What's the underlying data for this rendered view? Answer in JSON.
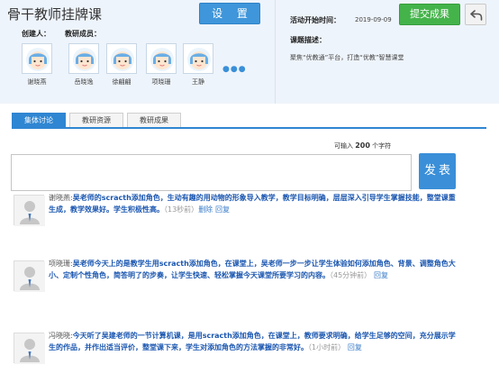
{
  "header": {
    "title": "骨干教师挂牌课",
    "settings_label": "设 置",
    "creator_label": "创建人：",
    "members_label": "教研成员："
  },
  "members": [
    {
      "name": "谢晓燕"
    },
    {
      "name": "岳晓逸"
    },
    {
      "name": "徐翩翩"
    },
    {
      "name": "项晓珊"
    },
    {
      "name": "王静"
    }
  ],
  "more_label": "●●●",
  "activity": {
    "start_label": "活动开始时间：",
    "start_date": "2019-09-09",
    "submit_label": "提交成果",
    "desc_label": "课题描述：",
    "desc_text": "聚焦“优教通”平台，打造“优教”智慧课堂"
  },
  "tabs": [
    {
      "label": "集体讨论",
      "active": true
    },
    {
      "label": "教研资源",
      "active": false
    },
    {
      "label": "教研成果",
      "active": false
    }
  ],
  "composer": {
    "hint_prefix": "可输入",
    "hint_count": "200",
    "hint_suffix": "个字符",
    "post_label": "发表"
  },
  "comments": [
    {
      "author": "谢晓燕:",
      "text": "吴老师的scracth添加角色，生动有趣的用动物的形象导入教学，教学目标明确，层层深入引导学生掌握技能，整堂课重生成，教学效果好。学生积极性高。",
      "time": "（13秒前）",
      "actions": [
        "删除",
        "回复"
      ]
    },
    {
      "author": "项晓珊:",
      "text": "吴老师今天上的是教学生用scracth添加角色，在课堂上，吴老师一步一步让学生体验如何添加角色、背景、调整角色大小、定制个性角色，简答明了的步奏，让学生快速、轻松掌握今天课堂所要学习的内容。",
      "time": "（45分钟前）",
      "actions": [
        "回复"
      ]
    },
    {
      "author": "冯晓晓:",
      "text": "今天听了吴建老师的一节计算机课，是用scracth添加角色，在课堂上，教师要求明确，给学生足够的空间，充分展示学生的作品，并作出适当评价，整堂课下来，学生对添加角色的方法掌握的非常好。",
      "time": "（1小时前）",
      "actions": [
        "回复"
      ]
    }
  ],
  "colors": {
    "header_bg": "#eef4fb",
    "primary_blue": "#3f96da",
    "tab_active": "#2f86d2",
    "submit_green": "#44b34a",
    "comment_text": "#1a56b0"
  }
}
